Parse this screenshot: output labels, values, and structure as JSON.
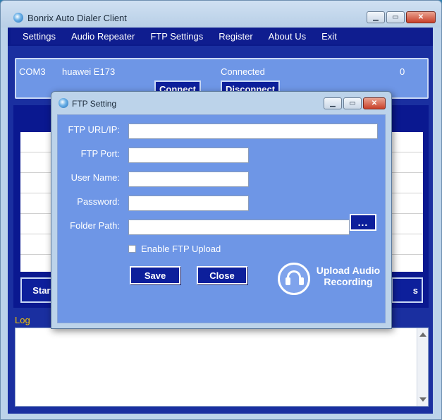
{
  "main_window": {
    "title": "Bonrix Auto Dialer Client",
    "menu": [
      "Settings",
      "Audio Repeater",
      "FTP Settings",
      "Register",
      "About Us",
      "Exit"
    ],
    "device": {
      "port": "COM3",
      "model": "huawei E173",
      "status": "Connected",
      "count": "0",
      "connect_label": "Connect",
      "disconnect_label": "Disconnect"
    },
    "start_label": "Start",
    "right_button_label": "s",
    "log_label": "Log",
    "list_row_count": 7
  },
  "ftp_dialog": {
    "title": "FTP Setting",
    "fields": {
      "url_label": "FTP URL/IP:",
      "url_value": "",
      "port_label": "FTP Port:",
      "port_value": "",
      "user_label": "User Name:",
      "user_value": "",
      "password_label": "Password:",
      "password_value": "",
      "folder_label": "Folder Path:",
      "folder_value": ""
    },
    "browse_label": "...",
    "enable_upload_label": "Enable FTP Upload",
    "enable_upload_checked": false,
    "save_label": "Save",
    "close_label": "Close",
    "upload_line1": "Upload Audio",
    "upload_line2": "Recording"
  },
  "colors": {
    "menu_bg": "#0f1d8f",
    "panel_bg": "#6e96e6",
    "button_bg": "#0d1f9b",
    "log_label": "#f5c400"
  },
  "icons": [
    "app-icon",
    "minimize-icon",
    "maximize-icon",
    "close-icon",
    "headphones-icon"
  ]
}
